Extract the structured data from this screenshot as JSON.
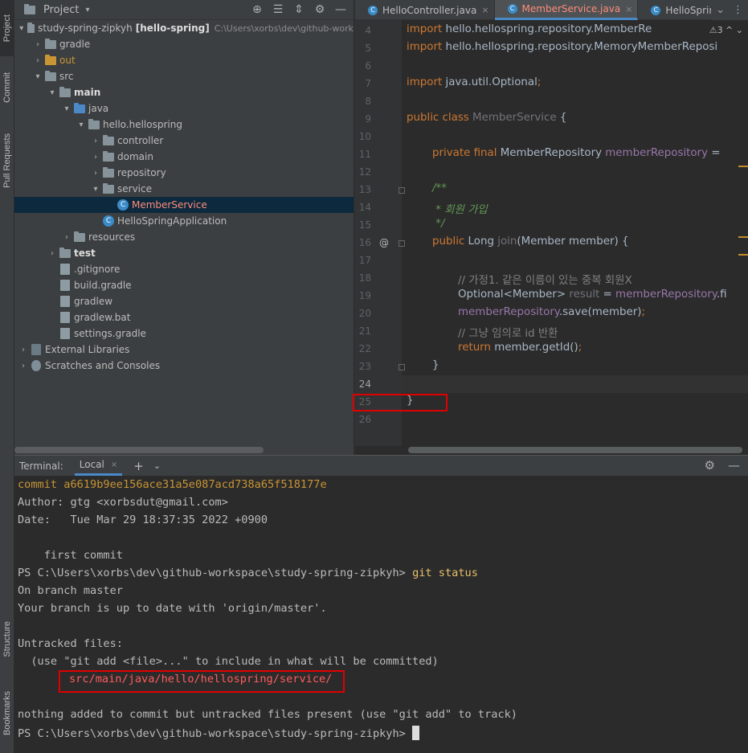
{
  "vbar": {
    "project": "Project",
    "commit": "Commit",
    "pull": "Pull Requests",
    "structure": "Structure",
    "bookmarks": "Bookmarks"
  },
  "project_panel": {
    "title": "Project",
    "caret": "▾",
    "tools": {
      "locate": "⊕",
      "collapse": "☰",
      "expand": "⇕",
      "gear": "⚙",
      "hide": "—"
    },
    "tree": [
      {
        "label": "study-spring-zipkyh",
        "extra": "[hello-spring]",
        "path": "C:\\Users\\xorbs\\dev\\github-work",
        "arrow": "▾",
        "icon": "folder",
        "indent": 4
      },
      {
        "label": "gradle",
        "arrow": "›",
        "icon": "folder",
        "indent": 22
      },
      {
        "label": "out",
        "arrow": "›",
        "icon": "folder-orange",
        "indent": 22,
        "color": "#c89535"
      },
      {
        "label": "src",
        "arrow": "▾",
        "icon": "folder",
        "indent": 22
      },
      {
        "label": "main",
        "arrow": "▾",
        "icon": "folder",
        "indent": 40,
        "bold": true
      },
      {
        "label": "java",
        "arrow": "▾",
        "icon": "folder-blue",
        "indent": 58
      },
      {
        "label": "hello.hellospring",
        "arrow": "▾",
        "icon": "folder",
        "indent": 76
      },
      {
        "label": "controller",
        "arrow": "›",
        "icon": "folder",
        "indent": 94
      },
      {
        "label": "domain",
        "arrow": "›",
        "icon": "folder",
        "indent": 94
      },
      {
        "label": "repository",
        "arrow": "›",
        "icon": "folder",
        "indent": 94
      },
      {
        "label": "service",
        "arrow": "▾",
        "icon": "folder",
        "indent": 94
      },
      {
        "label": "MemberService",
        "arrow": "",
        "icon": "class",
        "indent": 112,
        "selected": true,
        "color": "#ff8c7a"
      },
      {
        "label": "HelloSpringApplication",
        "arrow": "",
        "icon": "class",
        "indent": 94
      },
      {
        "label": "resources",
        "arrow": "›",
        "icon": "folder",
        "indent": 58
      },
      {
        "label": "test",
        "arrow": "›",
        "icon": "folder",
        "indent": 40,
        "bold": true
      },
      {
        "label": ".gitignore",
        "arrow": "",
        "icon": "file",
        "indent": 40
      },
      {
        "label": "build.gradle",
        "arrow": "",
        "icon": "file",
        "indent": 40
      },
      {
        "label": "gradlew",
        "arrow": "",
        "icon": "file",
        "indent": 40
      },
      {
        "label": "gradlew.bat",
        "arrow": "",
        "icon": "file",
        "indent": 40
      },
      {
        "label": "settings.gradle",
        "arrow": "",
        "icon": "file",
        "indent": 40
      },
      {
        "label": "External Libraries",
        "arrow": "›",
        "icon": "lib",
        "indent": 4
      },
      {
        "label": "Scratches and Consoles",
        "arrow": "›",
        "icon": "scratch",
        "indent": 4
      }
    ]
  },
  "editor": {
    "tabs": [
      {
        "label": "HelloController.java",
        "close": "×"
      },
      {
        "label": "MemberService.java",
        "close": "×",
        "active": true
      },
      {
        "label": "HelloSpringApp"
      }
    ],
    "tab_tools": {
      "more": "⌄",
      "menu": "⋮"
    },
    "warnings": "⚠3  ^  ⌄",
    "gutter_mark": "@",
    "line_numbers": [
      "4",
      "5",
      "6",
      "7",
      "8",
      "9",
      "10",
      "11",
      "12",
      "13",
      "14",
      "15",
      "16",
      "17",
      "18",
      "19",
      "20",
      "21",
      "22",
      "23",
      "24",
      "25",
      "26"
    ]
  },
  "terminal": {
    "title": "Terminal:",
    "tab": "Local",
    "tab_close": "×",
    "plus": "+",
    "chevron": "⌄",
    "gear": "⚙",
    "minimize": "—",
    "lines": {
      "commit": "commit a6619b9ee156ace31a5e087acd738a65f518177e",
      "author": "Author: gtg <xorbsdut@gmail.com>",
      "date": "Date:   Tue Mar 29 18:37:35 2022 +0900",
      "msg": "    first commit",
      "prompt1": "PS C:\\Users\\xorbs\\dev\\github-workspace\\study-spring-zipkyh> ",
      "cmd1": "git status",
      "branch": "On branch master",
      "uptodate": "Your branch is up to date with 'origin/master'.",
      "untracked": "Untracked files:",
      "hint": "  (use \"git add <file>...\" to include in what will be committed)",
      "file": "src/main/java/hello/hellospring/service/",
      "nothing": "nothing added to commit but untracked files present (use \"git add\" to track)",
      "prompt2": "PS C:\\Users\\xorbs\\dev\\github-workspace\\study-spring-zipkyh> "
    }
  },
  "code": {
    "l4_kw": "import",
    "l4": " hello.hellospring.repository.MemberRe",
    "l5_kw": "import",
    "l5": " hello.hellospring.repository.MemoryMemberReposi",
    "l7_kw": "import",
    "l7": " java.util.Optional",
    "l7_semi": ";",
    "l9_kw": "public class ",
    "l9_name": "MemberService",
    "l9_rest": " {",
    "l11_kw": "private final ",
    "l11_type": "MemberRepository ",
    "l11_field": "memberRepository",
    "l11_rest": " =",
    "l13": "/**",
    "l14": " * 회원 가입",
    "l15": " */",
    "l16_kw": "public ",
    "l16_type": "Long ",
    "l16_name": "join",
    "l16_rest": "(Member member) {",
    "l18": "// 가정1. 같은 이름이 있는 중복 회원X",
    "l19_type": "Optional<Member> ",
    "l19_var": "result",
    "l19_eq": " = ",
    "l19_field": "memberRepository",
    "l19_rest": ".fi",
    "l20_field": "memberRepository",
    "l20_rest": ".save(member)",
    "l20_semi": ";",
    "l21": "// 그냥 임의로 id 반환",
    "l22_kw": "return ",
    "l22_rest": "member.getId()",
    "l22_semi": ";",
    "l23": "}",
    "l25": "}"
  }
}
